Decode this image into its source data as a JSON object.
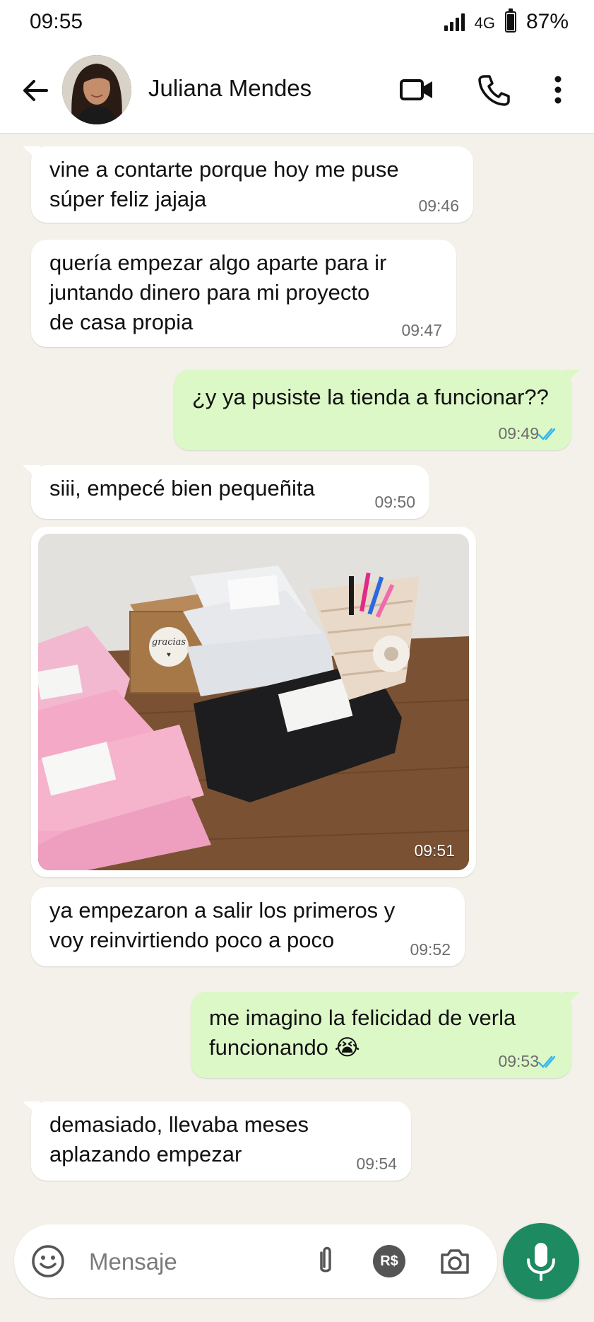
{
  "status_bar": {
    "time": "09:55",
    "network": "4G",
    "battery": "87%"
  },
  "header": {
    "contact_name": "Juliana Mendes"
  },
  "messages": [
    {
      "dir": "in",
      "lines": [
        "vine a contarte porque hoy me puse",
        "súper feliz jajaja"
      ],
      "time": "09:46"
    },
    {
      "dir": "in",
      "lines": [
        "quería empezar algo aparte para ir",
        "juntando dinero para mi proyecto",
        "de casa propia"
      ],
      "time": "09:47"
    },
    {
      "dir": "out",
      "lines": [
        "¿y ya pusiste la tienda a funcionar??"
      ],
      "time": "09:49"
    },
    {
      "dir": "in",
      "lines": [
        "siii, empecé bien pequeñita"
      ],
      "time": "09:50"
    },
    {
      "dir": "in",
      "photo_time": "09:51",
      "box_label": "gracias"
    },
    {
      "dir": "in",
      "lines": [
        "ya empezaron a salir los primeros y",
        "voy reinvirtiendo poco a poco"
      ],
      "time": "09:52"
    },
    {
      "dir": "out",
      "lines": [
        "me imagino la felicidad de verla",
        "funcionando 😭"
      ],
      "time": "09:53"
    },
    {
      "dir": "in",
      "lines": [
        "demasiado, llevaba meses",
        "aplazando empezar"
      ],
      "time": "09:54"
    }
  ],
  "composer": {
    "placeholder": "Mensaje",
    "currency_label": "R$"
  },
  "colors": {
    "incoming": "#ffffff",
    "outgoing": "#dcf8c6",
    "accent": "#1e8a62",
    "read_checks": "#34b7f1"
  }
}
